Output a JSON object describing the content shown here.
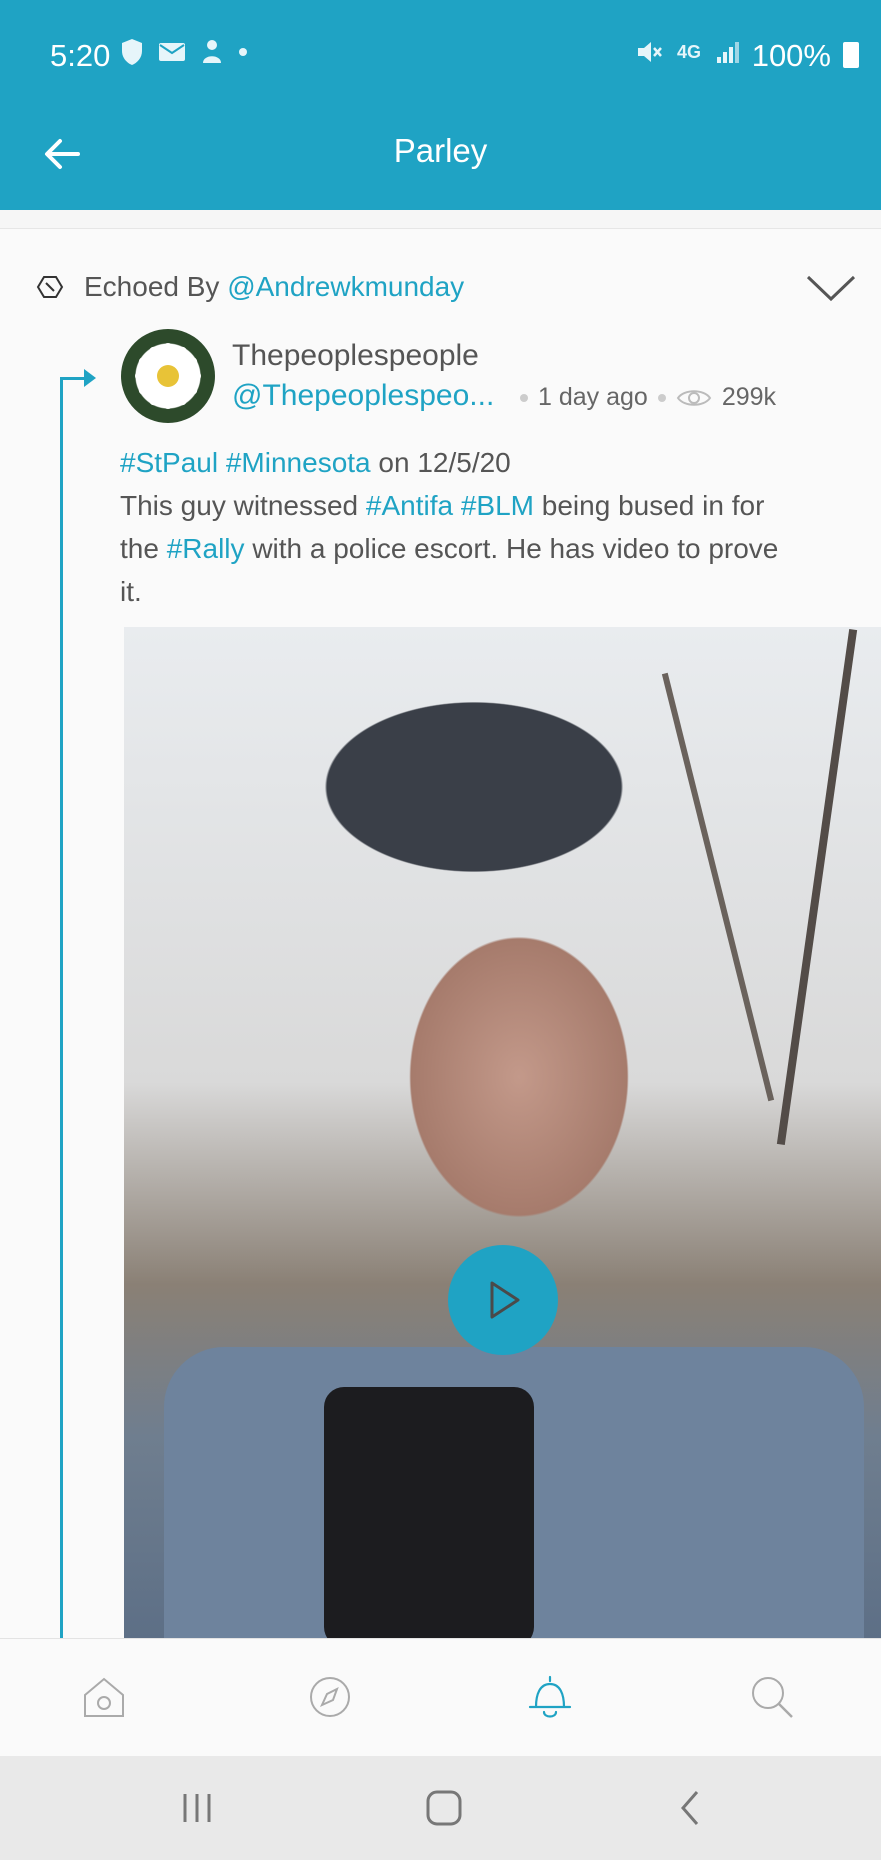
{
  "status_bar": {
    "time": "5:20",
    "battery": "100%",
    "network": "4G"
  },
  "app_bar": {
    "title": "Parley",
    "back_icon": "arrow-left-icon"
  },
  "post": {
    "echo_label": "Echoed By",
    "echo_user": "@Andrewkmunday",
    "author_name": "Thepeoplespeople",
    "author_handle": "@Thepeoplespeo...",
    "time_ago": "1 day ago",
    "views": "299k",
    "text": {
      "line1_tag1": "#StPaul",
      "line1_tag2": "#Minnesota",
      "line1_rest": "on 12/5/20",
      "line2_pre": "This guy witnessed",
      "line2_tag1": "#Antifa",
      "line2_tag2": "#BLM",
      "line2_post": "being bused in for",
      "line3_pre": "the",
      "line3_tag": "#Rally",
      "line3_post": "with a police escort. He has video to prove",
      "line4": "it."
    }
  },
  "bottom_nav": {
    "items": [
      "home-icon",
      "compass-icon",
      "bell-icon",
      "search-icon"
    ],
    "active": "bell-icon"
  },
  "colors": {
    "accent": "#1fa3c4",
    "text": "#555555"
  }
}
